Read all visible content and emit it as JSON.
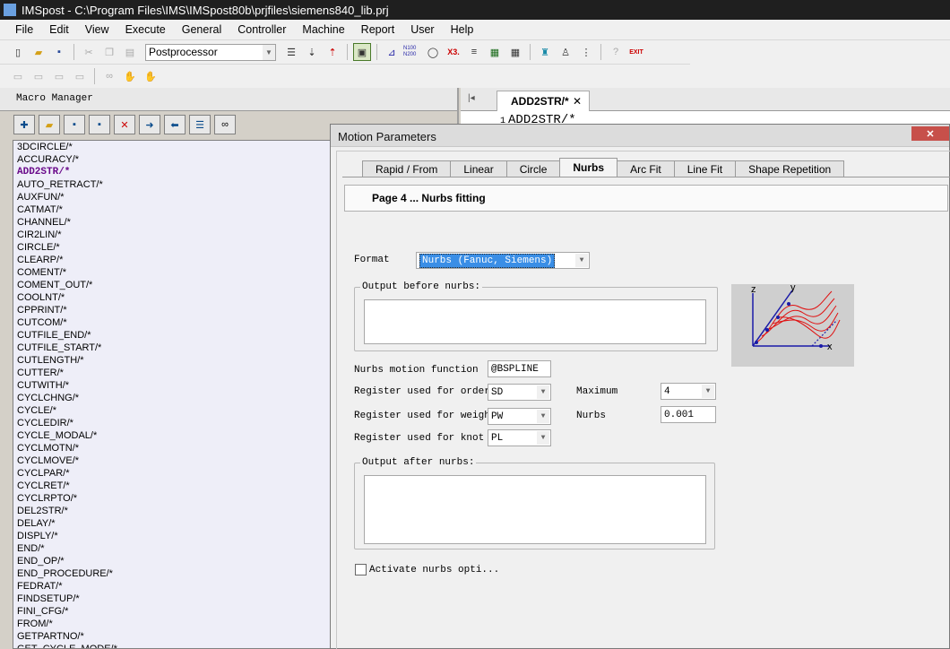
{
  "window": {
    "title": "IMSpost - C:\\Program Files\\IMS\\IMSpost80b\\prjfiles\\siemens840_lib.prj"
  },
  "menu": [
    "File",
    "Edit",
    "View",
    "Execute",
    "General",
    "Controller",
    "Machine",
    "Report",
    "User",
    "Help"
  ],
  "toolbar": {
    "postprocessor_select": "Postprocessor",
    "n100_label": "N100\nN200",
    "x3_label": "X3."
  },
  "macro_manager": {
    "title": "Macro Manager",
    "items": [
      "3DCIRCLE/*",
      "ACCURACY/*",
      "ADD2STR/*",
      "AUTO_RETRACT/*",
      "AUXFUN/*",
      "CATMAT/*",
      "CHANNEL/*",
      "CIR2LIN/*",
      "CIRCLE/*",
      "CLEARP/*",
      "COMENT/*",
      "COMENT_OUT/*",
      "COOLNT/*",
      "CPPRINT/*",
      "CUTCOM/*",
      "CUTFILE_END/*",
      "CUTFILE_START/*",
      "CUTLENGTH/*",
      "CUTTER/*",
      "CUTWITH/*",
      "CYCLCHNG/*",
      "CYCLE/*",
      "CYCLEDIR/*",
      "CYCLE_MODAL/*",
      "CYCLMOTN/*",
      "CYCLMOVE/*",
      "CYCLPAR/*",
      "CYCLRET/*",
      "CYCLRPTO/*",
      "DEL2STR/*",
      "DELAY/*",
      "DISPLY/*",
      "END/*",
      "END_OP/*",
      "END_PROCEDURE/*",
      "FEDRAT/*",
      "FINDSETUP/*",
      "FINI_CFG/*",
      "FROM/*",
      "GETPARTNO/*",
      "GET_CYCLE_MODE/*"
    ],
    "selected_index": 2
  },
  "editor": {
    "tab_label": "ADD2STR/*",
    "line_number": "1",
    "line_text": "ADD2STR/*"
  },
  "dialog": {
    "title": "Motion Parameters",
    "tabs": [
      "Rapid / From",
      "Linear",
      "Circle",
      "Nurbs",
      "Arc Fit",
      "Line Fit",
      "Shape Repetition"
    ],
    "active_tab": "Nurbs",
    "page_header": "Page 4 ... Nurbs fitting",
    "format_label": "Format",
    "format_value": "Nurbs (Fanuc, Siemens)",
    "output_before_label": "Output before nurbs:",
    "motion_function_label": "Nurbs motion function",
    "motion_function_value": "@BSPLINE",
    "reg_order_label": "Register used for order",
    "reg_order_value": "SD",
    "reg_weight_label": "Register used for weight",
    "reg_weight_value": "PW",
    "reg_knot_label": "Register used for knot",
    "reg_knot_value": "PL",
    "maximum_label": "Maximum",
    "maximum_value": "4",
    "nurbs_label": "Nurbs",
    "nurbs_value": "0.001",
    "output_after_label": "Output after nurbs:",
    "activate_label": "Activate nurbs opti...",
    "image_axes": {
      "z": "z",
      "y": "y",
      "x": "x"
    }
  },
  "colors": {
    "selected_macro": "#6a0a8a",
    "format_highlight": "#3a8ee6",
    "close_button": "#c7504a",
    "curve": "#e01010",
    "axis": "#1a1aa8"
  }
}
